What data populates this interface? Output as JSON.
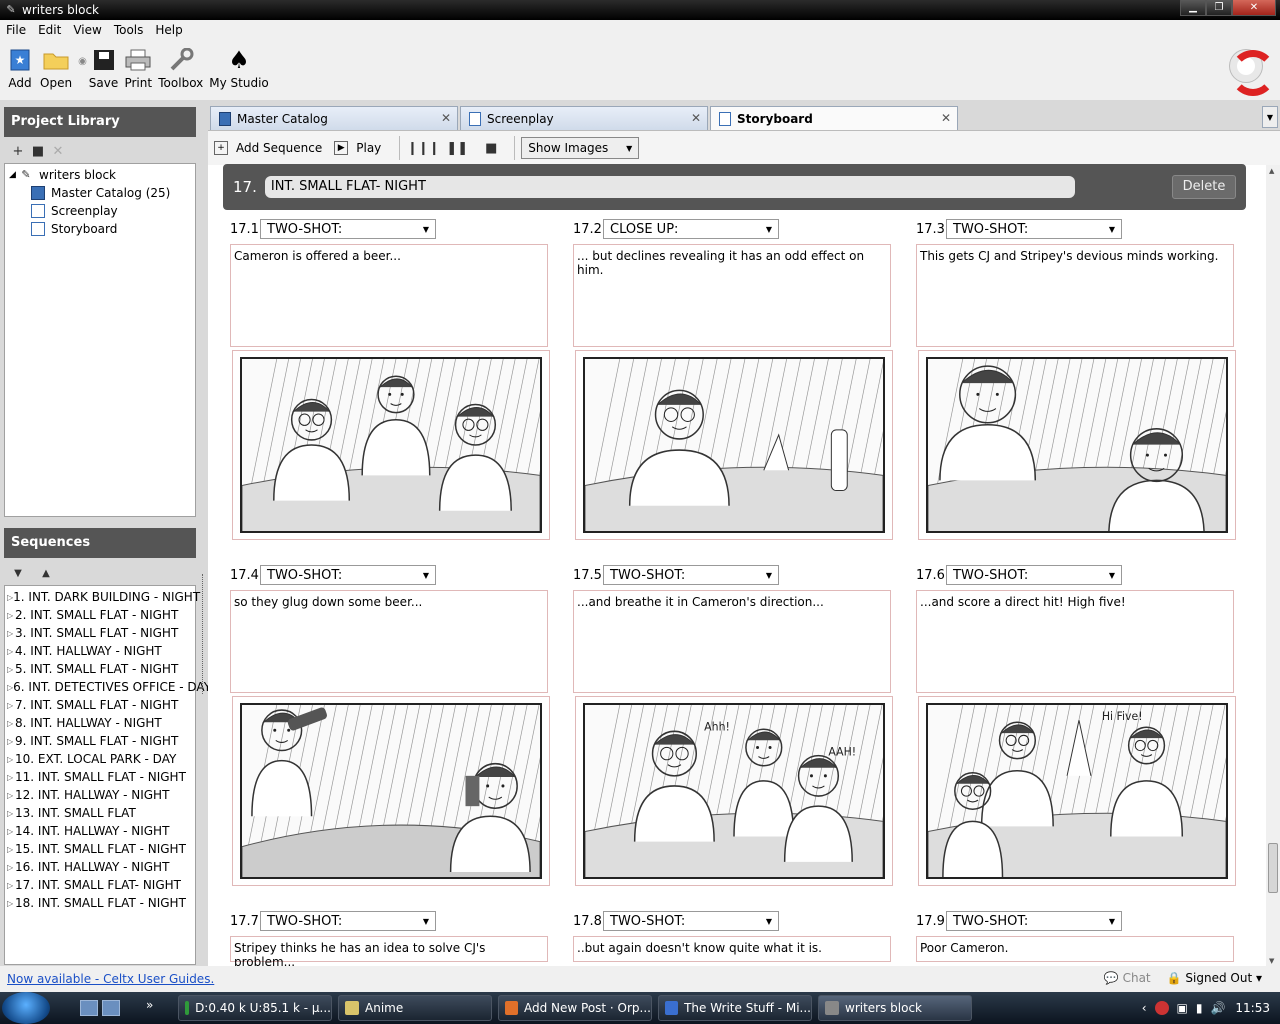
{
  "window": {
    "title": "writers block"
  },
  "menu": [
    "File",
    "Edit",
    "View",
    "Tools",
    "Help"
  ],
  "toolbar": [
    {
      "label": "Add",
      "icon": "add-icon"
    },
    {
      "label": "Open",
      "icon": "folder-icon"
    },
    {
      "label": "Save",
      "icon": "save-icon"
    },
    {
      "label": "Print",
      "icon": "printer-icon"
    },
    {
      "label": "Toolbox",
      "icon": "wrench-icon"
    },
    {
      "label": "My Studio",
      "icon": "spade-icon"
    }
  ],
  "project_library": {
    "title": "Project Library",
    "tree": {
      "root": "writers block",
      "children": [
        "Master Catalog (25)",
        "Screenplay",
        "Storyboard"
      ]
    }
  },
  "sequences": {
    "title": "Sequences",
    "items": [
      "1. INT. DARK BUILDING - NIGHT",
      "2. INT. SMALL FLAT - NIGHT",
      "3. INT. SMALL FLAT - NIGHT",
      "4. INT. HALLWAY - NIGHT",
      "5. INT. SMALL FLAT - NIGHT",
      "6. INT. DETECTIVES OFFICE - DAY",
      "7. INT. SMALL FLAT - NIGHT",
      "8. INT. HALLWAY - NIGHT",
      "9. INT. SMALL FLAT - NIGHT",
      "10. EXT. LOCAL PARK - DAY",
      "11. INT. SMALL FLAT - NIGHT",
      "12. INT. HALLWAY - NIGHT",
      "13. INT. SMALL FLAT",
      "14. INT. HALLWAY - NIGHT",
      "15. INT. SMALL FLAT - NIGHT",
      "16. INT. HALLWAY - NIGHT",
      "17. INT. SMALL FLAT- NIGHT",
      "18. INT. SMALL FLAT - NIGHT"
    ]
  },
  "tabs": [
    {
      "label": "Master Catalog",
      "active": false
    },
    {
      "label": "Screenplay",
      "active": false
    },
    {
      "label": "Storyboard",
      "active": true
    }
  ],
  "storyboard_toolbar": {
    "add_sequence": "Add Sequence",
    "play": "Play",
    "view_select": "Show Images"
  },
  "scene": {
    "number": "17.",
    "heading": "INT. SMALL FLAT- NIGHT",
    "delete_label": "Delete"
  },
  "shots": [
    {
      "number": "17.1",
      "type": "TWO-SHOT:",
      "text": "Cameron is offered a beer..."
    },
    {
      "number": "17.2",
      "type": "CLOSE UP:",
      "text": "... but declines revealing it has an odd effect on him."
    },
    {
      "number": "17.3",
      "type": "TWO-SHOT:",
      "text": "This gets CJ and Stripey's devious minds working."
    },
    {
      "number": "17.4",
      "type": "TWO-SHOT:",
      "text": "so they glug down some beer..."
    },
    {
      "number": "17.5",
      "type": "TWO-SHOT:",
      "text": "...and breathe it in Cameron's direction..."
    },
    {
      "number": "17.6",
      "type": "TWO-SHOT:",
      "text": "...and score a direct hit! High five!"
    },
    {
      "number": "17.7",
      "type": "TWO-SHOT:",
      "text": "Stripey thinks he has an idea to solve CJ's problem..."
    },
    {
      "number": "17.8",
      "type": "TWO-SHOT:",
      "text": "..but again doesn't know quite what it is."
    },
    {
      "number": "17.9",
      "type": "TWO-SHOT:",
      "text": "Poor Cameron."
    }
  ],
  "sketch_text": {
    "s5a": "Ahh!",
    "s5b": "AAH!",
    "s6": "Hi Five!"
  },
  "statusbar": {
    "link": "Now available - Celtx User Guides.",
    "chat": "Chat",
    "signed": "Signed Out"
  },
  "taskbar": {
    "tasks": [
      {
        "label": "D:0.40 k U:85.1 k - µ...",
        "color": "#2f9a3a"
      },
      {
        "label": "Anime",
        "color": "#d9c46a"
      },
      {
        "label": "Add New Post · Orp...",
        "color": "#e0702a"
      },
      {
        "label": "The Write Stuff - Mi...",
        "color": "#3a6fd0"
      },
      {
        "label": "writers block",
        "color": "#888888"
      }
    ],
    "clock": "11:53"
  }
}
